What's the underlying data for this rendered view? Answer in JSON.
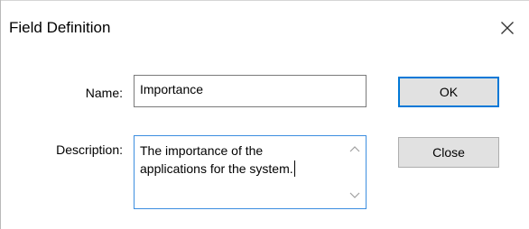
{
  "dialog": {
    "title": "Field Definition",
    "close_icon": "close-icon"
  },
  "form": {
    "name_label": "Name:",
    "name_value": "Importance",
    "description_label": "Description:",
    "description_value": "The importance of the\napplications for the system."
  },
  "buttons": {
    "ok_label": "OK",
    "close_label": "Close"
  },
  "colors": {
    "focus_border": "#3c8ee0",
    "default_button_border": "#0078d7",
    "button_face": "#e1e1e1"
  }
}
